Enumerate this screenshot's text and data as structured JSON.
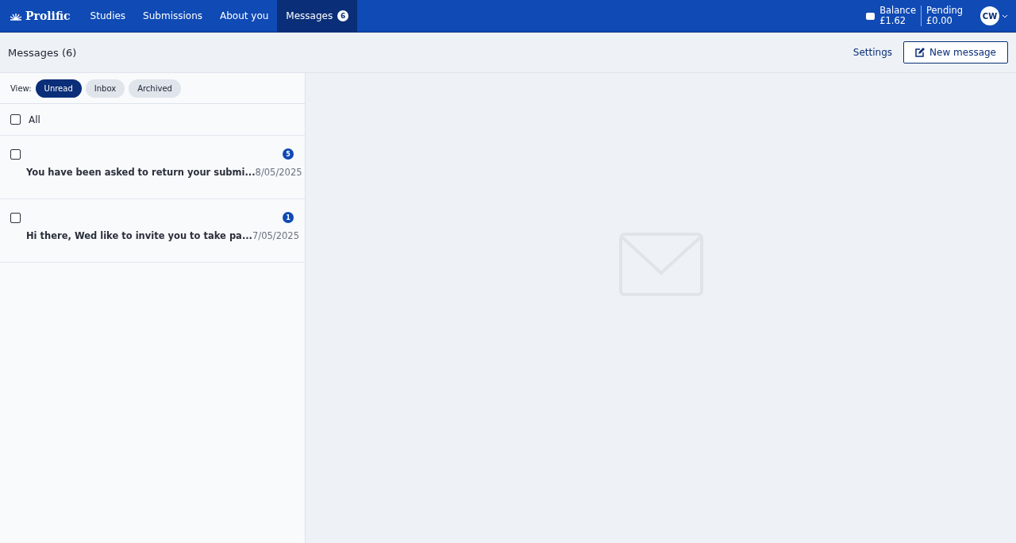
{
  "nav": {
    "logo": "Prolific",
    "items": [
      {
        "label": "Studies",
        "selected": false
      },
      {
        "label": "Submissions",
        "selected": false
      },
      {
        "label": "About you",
        "selected": false
      },
      {
        "label": "Messages",
        "selected": true,
        "badge": "6"
      }
    ],
    "balance": {
      "label": "Balance",
      "value": "£1.62"
    },
    "pending": {
      "label": "Pending",
      "value": "£0.00"
    },
    "avatar": "CW"
  },
  "header": {
    "title": "Messages (6)",
    "settings": "Settings",
    "new_message": "New message"
  },
  "view": {
    "label": "View:",
    "filters": [
      {
        "label": "Unread",
        "selected": true
      },
      {
        "label": "Inbox",
        "selected": false
      },
      {
        "label": "Archived",
        "selected": false
      }
    ]
  },
  "select_all": {
    "label": "All",
    "checked": false
  },
  "messages": [
    {
      "checked": false,
      "count": "5",
      "preview": "You have been asked to return your submi...",
      "date": "8/05/2025"
    },
    {
      "checked": false,
      "count": "1",
      "preview": "Hi there, Wed like to invite you to take pa...",
      "date": "7/05/2025"
    }
  ]
}
